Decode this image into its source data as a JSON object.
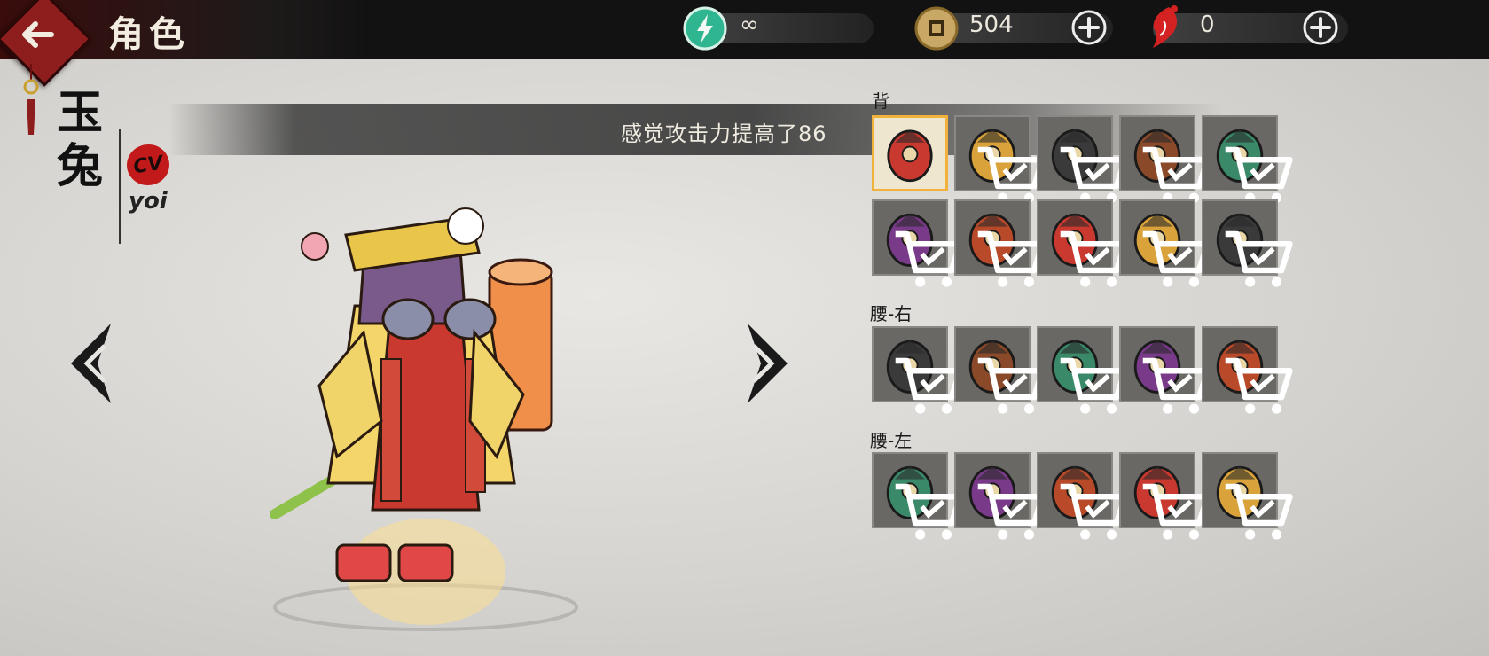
{
  "header": {
    "title": "角色",
    "back_icon": "back-arrow-icon",
    "resources": [
      {
        "name": "energy",
        "icon": "lightning-icon",
        "value": "∞",
        "has_plus": false
      },
      {
        "name": "coins",
        "icon": "coin-icon",
        "value": "504",
        "has_plus": true
      },
      {
        "name": "red-gem",
        "icon": "red-feather-icon",
        "value": "0",
        "has_plus": true
      }
    ]
  },
  "character": {
    "name": "玉兔",
    "cv_badge": "CV",
    "cv_name": "yoi"
  },
  "notice": "感觉攻击力提高了86",
  "sections": [
    {
      "label": "背",
      "rows": 2,
      "items": [
        {
          "icon": "mouse-backpack-icon",
          "selected": true,
          "locked": false
        },
        {
          "icon": "scroll-backpack-icon",
          "selected": false,
          "locked": true
        },
        {
          "icon": "red-gourd-icon",
          "selected": false,
          "locked": true
        },
        {
          "icon": "black-wing-icon",
          "selected": false,
          "locked": true
        },
        {
          "icon": "red-flame-wheel-icon",
          "selected": false,
          "locked": true
        },
        {
          "icon": "red-cape-icon",
          "selected": false,
          "locked": true
        },
        {
          "icon": "bat-wing-icon",
          "selected": false,
          "locked": true
        },
        {
          "icon": "fire-wing-icon",
          "selected": false,
          "locked": true
        },
        {
          "icon": "red-mask-icon",
          "selected": false,
          "locked": true
        },
        {
          "icon": "gold-shield-icon",
          "selected": false,
          "locked": true
        }
      ]
    },
    {
      "label": "腰-右",
      "rows": 1,
      "items": [
        {
          "icon": "green-tassel-icon",
          "selected": false,
          "locked": true
        },
        {
          "icon": "red-charm-icon",
          "selected": false,
          "locked": true
        },
        {
          "icon": "green-feather-icon",
          "selected": false,
          "locked": true
        },
        {
          "icon": "purple-grape-icon",
          "selected": false,
          "locked": true
        },
        {
          "icon": "red-pouch-icon",
          "selected": false,
          "locked": true
        }
      ]
    },
    {
      "label": "腰-左",
      "rows": 1,
      "items": [
        {
          "icon": "gray-cat-icon",
          "selected": false,
          "locked": true
        },
        {
          "icon": "red-rope-icon",
          "selected": false,
          "locked": true
        },
        {
          "icon": "bell-gourd-icon",
          "selected": false,
          "locked": true
        },
        {
          "icon": "gold-bell-icon",
          "selected": false,
          "locked": true
        },
        {
          "icon": "jade-brush-icon",
          "selected": false,
          "locked": true
        }
      ]
    }
  ],
  "colors": {
    "selected_border": "#f0b23a",
    "slot_bg": "#6a6865",
    "accent_red": "#8e1d1d"
  }
}
